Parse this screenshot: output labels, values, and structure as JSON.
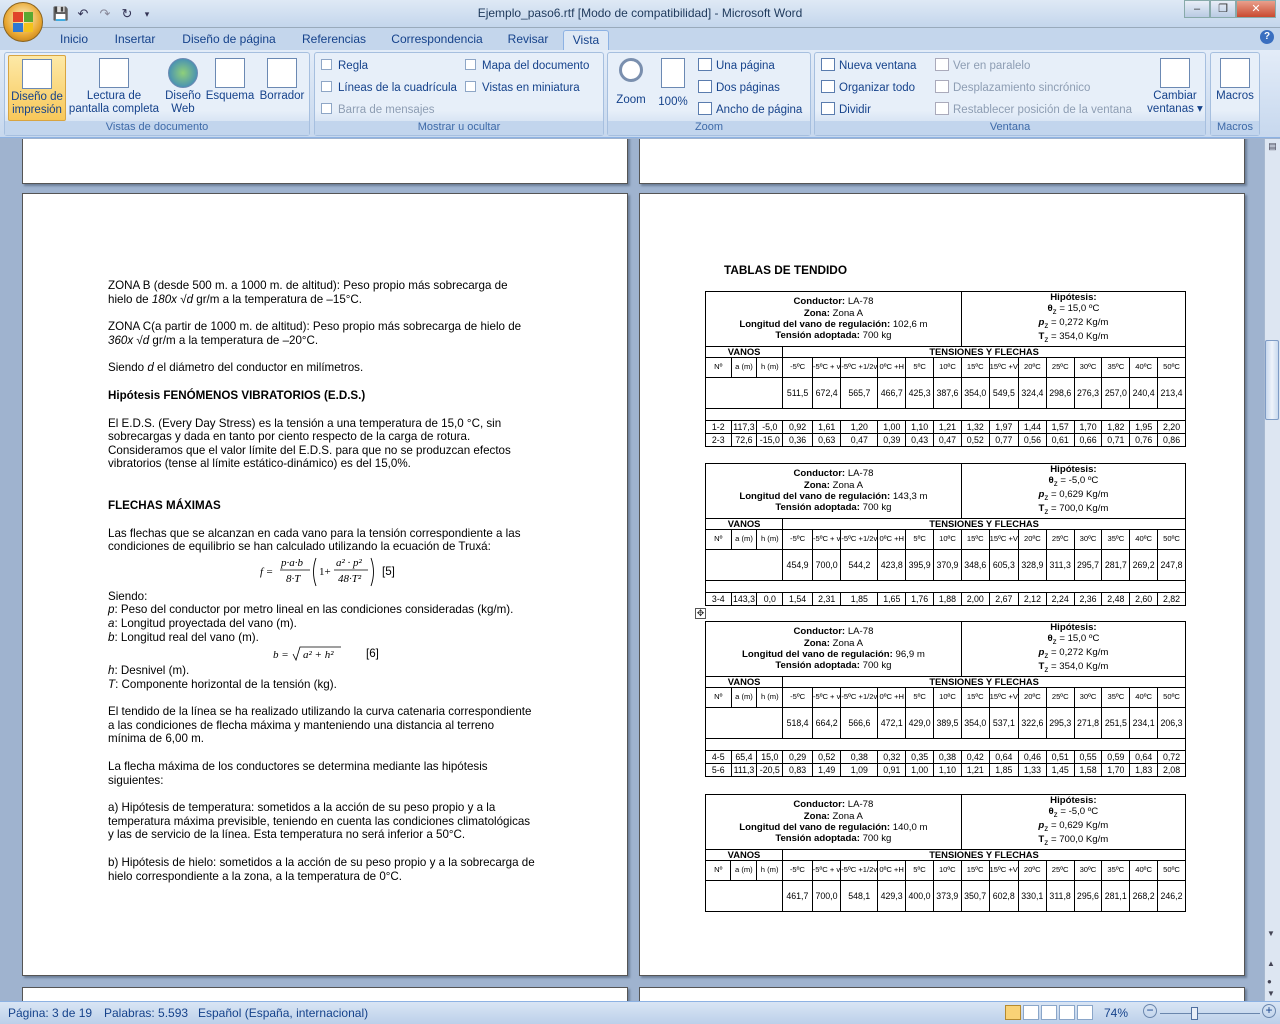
{
  "window": {
    "title": "Ejemplo_paso6.rtf [Modo de compatibilidad] - Microsoft Word"
  },
  "tabs": [
    "Inicio",
    "Insertar",
    "Diseño de página",
    "Referencias",
    "Correspondencia",
    "Revisar",
    "Vista"
  ],
  "ribbon": {
    "vistas": {
      "label": "Vistas de documento",
      "print_layout": [
        "Diseño de",
        "impresión"
      ],
      "full_screen": [
        "Lectura de",
        "pantalla completa"
      ],
      "web": [
        "Diseño",
        "Web"
      ],
      "outline": "Esquema",
      "draft": "Borrador"
    },
    "mostrar": {
      "label": "Mostrar u ocultar",
      "regla": "Regla",
      "lineas": "Líneas de la cuadrícula",
      "barra": "Barra de mensajes",
      "mapa": "Mapa del documento",
      "miniaturas": "Vistas en miniatura"
    },
    "zoom": {
      "label": "Zoom",
      "zoom": "Zoom",
      "pct": "100%",
      "una": "Una página",
      "dos": "Dos páginas",
      "ancho": "Ancho de página"
    },
    "ventana": {
      "label": "Ventana",
      "nueva": "Nueva ventana",
      "organizar": "Organizar todo",
      "dividir": "Dividir",
      "paralelo": "Ver en paralelo",
      "sincronico": "Desplazamiento sincrónico",
      "restablecer": "Restablecer posición de la ventana",
      "cambiar": [
        "Cambiar",
        "ventanas ▾"
      ]
    },
    "macros": {
      "label": "Macros",
      "btn": "Macros"
    }
  },
  "left_page": {
    "p1a": "ZONA B (desde 500 m. a 1000 m. de altitud): Peso propio más sobrecarga de",
    "p1b_pre": "hielo de ",
    "p1b_em": "180x √d",
    "p1b_post": " gr/m a la temperatura de –15°C.",
    "p2a": "ZONA C(a partir de 1000 m. de altitud): Peso propio más sobrecarga de hielo de",
    "p2b_em": "360x √d",
    "p2b_post": " gr/m a la temperatura de –20°C.",
    "p3_pre": "Siendo ",
    "p3_em": "d",
    "p3_post": " el diámetro del conductor en milímetros.",
    "h_eds": "Hipótesis FENÓMENOS VIBRATORIOS (E.D.S.)",
    "p4": [
      "El E.D.S. (Every Day Stress) es la tensión a una temperatura de 15,0 °C, sin",
      "sobrecargas y dada en tanto por ciento respecto de la carga de rotura.",
      "Consideramos que el valor límite del E.D.S. para que no se produzcan efectos",
      "vibratorios (tense al  límite estático-dinámico) es del 15,0%."
    ],
    "h_flechas": "FLECHAS MÁXIMAS",
    "p5": [
      "Las flechas que se alcanzan en cada vano para la tensión correspondiente a las",
      "condiciones de equilibrio se han calculado utilizando la ecuación de Truxá:"
    ],
    "eq5": "[5]",
    "siendo": "Siendo:",
    "defs": [
      [
        "p",
        "Peso del conductor por metro lineal en las condiciones consideradas (kg/m)."
      ],
      [
        "a",
        "Longitud proyectada del vano (m)."
      ],
      [
        "b",
        "Longitud real del vano (m)."
      ]
    ],
    "eq6": "[6]",
    "defs2": [
      [
        "h",
        "Desnivel (m)."
      ],
      [
        "T",
        "Componente horizontal de la tensión (kg)."
      ]
    ],
    "p6": [
      "El tendido de la línea se ha realizado utilizando la curva catenaria correspondiente",
      "a las condiciones de flecha máxima y manteniendo una distancia al terreno",
      "mínima de 6,00 m."
    ],
    "p7": [
      "La flecha máxima de los conductores se determina mediante las hipótesis",
      "siguientes:"
    ],
    "p8": [
      "a) Hipótesis de temperatura: sometidos a la acción de su peso propio y a la",
      "temperatura máxima previsible, teniendo en cuenta las condiciones climatológicas",
      "y las de servicio de la línea. Esta temperatura no será inferior a 50°C."
    ],
    "p9": [
      "b) Hipótesis de hielo: sometidos a la acción de su peso propio y a la sobrecarga de",
      "hielo correspondiente a la zona, a la temperatura de 0°C."
    ]
  },
  "right_page": {
    "title": "TABLAS DE TENDIDO",
    "labels": {
      "conductor": "Conductor:",
      "zona": "Zona:",
      "longitud": "Longitud del vano de regulación:",
      "tension": "Tensión adoptada:",
      "hipotesis": "Hipótesis:",
      "vanos": "VANOS",
      "tyf": "TENSIONES Y FLECHAS",
      "n": "Nº",
      "a": "a (m)",
      "h": "h (m)"
    },
    "cols": [
      "-5ºC",
      "-5ºC + v",
      "-5ºC +1/2v",
      "0ºC +H",
      "5ºC",
      "10ºC",
      "15ºC",
      "15ºC +V",
      "20ºC",
      "25ºC",
      "30ºC",
      "35ºC",
      "40ºC",
      "50ºC"
    ],
    "tables": [
      {
        "conductor": "LA-78",
        "zona": "Zona A",
        "longitud": "102,6 m",
        "tension": "700 kg",
        "theta": "= 15,0 ºC",
        "p": "= 0,272 Kg/m",
        "T": "= 354,0 Kg/m",
        "tensions": [
          "511,5",
          "672,4",
          "565,7",
          "466,7",
          "425,3",
          "387,6",
          "354,0",
          "549,5",
          "324,4",
          "298,6",
          "276,3",
          "257,0",
          "240,4",
          "213,4"
        ],
        "rows": [
          [
            "1-2",
            "117,3",
            "-5,0",
            "0,92",
            "1,61",
            "1,20",
            "1,00",
            "1,10",
            "1,21",
            "1,32",
            "1,97",
            "1,44",
            "1,57",
            "1,70",
            "1,82",
            "1,95",
            "2,20"
          ],
          [
            "2-3",
            "72,6",
            "-15,0",
            "0,36",
            "0,63",
            "0,47",
            "0,39",
            "0,43",
            "0,47",
            "0,52",
            "0,77",
            "0,56",
            "0,61",
            "0,66",
            "0,71",
            "0,76",
            "0,86"
          ]
        ]
      },
      {
        "conductor": "LA-78",
        "zona": "Zona A",
        "longitud": "143,3 m",
        "tension": "700 kg",
        "theta": "= -5,0 ºC",
        "p": "= 0,629 Kg/m",
        "T": "= 700,0 Kg/m",
        "tensions": [
          "454,9",
          "700,0",
          "544,2",
          "423,8",
          "395,9",
          "370,9",
          "348,6",
          "605,3",
          "328,9",
          "311,3",
          "295,7",
          "281,7",
          "269,2",
          "247,8"
        ],
        "rows": [
          [
            "3-4",
            "143,3",
            "0,0",
            "1,54",
            "2,31",
            "1,85",
            "1,65",
            "1,76",
            "1,88",
            "2,00",
            "2,67",
            "2,12",
            "2,24",
            "2,36",
            "2,48",
            "2,60",
            "2,82"
          ]
        ]
      },
      {
        "conductor": "LA-78",
        "zona": "Zona A",
        "longitud": "96,9 m",
        "tension": "700 kg",
        "theta": "= 15,0 ºC",
        "p": "= 0,272 Kg/m",
        "T": "= 354,0 Kg/m",
        "tensions": [
          "518,4",
          "664,2",
          "566,6",
          "472,1",
          "429,0",
          "389,5",
          "354,0",
          "537,1",
          "322,6",
          "295,3",
          "271,8",
          "251,5",
          "234,1",
          "206,3"
        ],
        "rows": [
          [
            "4-5",
            "65,4",
            "15,0",
            "0,29",
            "0,52",
            "0,38",
            "0,32",
            "0,35",
            "0,38",
            "0,42",
            "0,64",
            "0,46",
            "0,51",
            "0,55",
            "0,59",
            "0,64",
            "0,72"
          ],
          [
            "5-6",
            "111,3",
            "-20,5",
            "0,83",
            "1,49",
            "1,09",
            "0,91",
            "1,00",
            "1,10",
            "1,21",
            "1,85",
            "1,33",
            "1,45",
            "1,58",
            "1,70",
            "1,83",
            "2,08"
          ]
        ]
      },
      {
        "conductor": "LA-78",
        "zona": "Zona A",
        "longitud": "140,0 m",
        "tension": "700 kg",
        "theta": "= -5,0 ºC",
        "p": "= 0,629 Kg/m",
        "T": "= 700,0 Kg/m",
        "tensions": [
          "461,7",
          "700,0",
          "548,1",
          "429,3",
          "400,0",
          "373,9",
          "350,7",
          "602,8",
          "330,1",
          "311,8",
          "295,6",
          "281,1",
          "268,2",
          "246,2"
        ],
        "rows": []
      }
    ]
  },
  "status": {
    "page": "Página: 3 de 19",
    "words": "Palabras: 5.593",
    "lang": "Español (España, internacional)",
    "zoom": "74%"
  }
}
